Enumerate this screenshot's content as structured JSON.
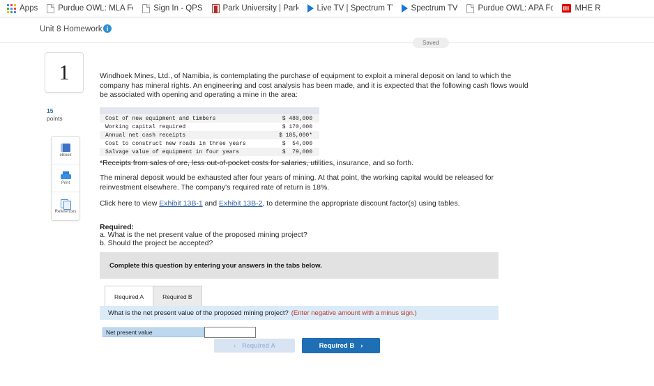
{
  "browser": {
    "apps_label": "Apps",
    "bookmarks": [
      {
        "label": "Purdue OWL: MLA Fo",
        "icon": "page-icon"
      },
      {
        "label": "Sign In - QPS",
        "icon": "page-icon"
      },
      {
        "label": "Park University | Park",
        "icon": "park-university-icon"
      },
      {
        "label": "Live TV | Spectrum TV",
        "icon": "play-triangle-icon"
      },
      {
        "label": "Spectrum TV",
        "icon": "play-triangle-icon"
      },
      {
        "label": "Purdue OWL: APA Fo",
        "icon": "page-icon"
      },
      {
        "label": "MHE R",
        "icon": "mhe-icon"
      }
    ]
  },
  "header": {
    "title": "Unit 8 Homework",
    "info_tooltip": "i",
    "status_badge": "Saved"
  },
  "sidebar": {
    "question_number": "1",
    "points_value": "15",
    "points_label": "points",
    "tools": [
      {
        "label": "eBook",
        "icon": "ebook-icon"
      },
      {
        "label": "Print",
        "icon": "printer-icon"
      },
      {
        "label": "References",
        "icon": "references-icon"
      }
    ]
  },
  "question": {
    "intro": "Windhoek Mines, Ltd., of Namibia, is contemplating the purchase of equipment to exploit a mineral deposit on land to which the company has mineral rights. An engineering and cost analysis has been made, and it is expected that the following cash flows would be associated with opening and operating a mine in the area:",
    "table": {
      "rows": [
        {
          "label": "Cost of new equipment and timbers",
          "amount": "$ 480,000"
        },
        {
          "label": "Working capital required",
          "amount": "$ 170,000"
        },
        {
          "label": "Annual net cash receipts",
          "amount": "$ 185,000*"
        },
        {
          "label": "Cost to construct new roads in three years",
          "amount": "$  54,000"
        },
        {
          "label": "Salvage value of equipment in four years",
          "amount": "$  79,000"
        }
      ]
    },
    "footnote": "*Receipts from sales of ore, less out-of-pocket costs for salaries, utilities, insurance, and so forth.",
    "para2": "The mineral deposit would be exhausted after four years of mining. At that point, the working capital would be released for reinvestment elsewhere. The company's required rate of return is 18%.",
    "para3_prefix": "Click here to view ",
    "exhibit_link_1": "Exhibit 13B-1",
    "para3_mid": " and ",
    "exhibit_link_2": "Exhibit 13B-2",
    "para3_suffix": ", to determine the appropriate discount factor(s) using tables.",
    "required_heading": "Required:",
    "required_a": "a. What is the net present value of the proposed mining project?",
    "required_b": "b. Should the project be accepted?"
  },
  "answer_panel": {
    "complete_banner": "Complete this question by entering your answers in the tabs below.",
    "tabs": [
      {
        "label": "Required A",
        "active": true
      },
      {
        "label": "Required B",
        "active": false
      }
    ],
    "prompt": "What is the net present value of the proposed mining project?",
    "prompt_hint": "(Enter negative amount with a minus sign.)",
    "field_label": "Net present value",
    "field_value": "",
    "field_placeholder": "",
    "prev_button": "Required A",
    "prev_chevron": "‹",
    "next_button": "Required B",
    "next_chevron": "›"
  },
  "colors": {
    "accent_blue": "#1f6fb5",
    "link_blue": "#2f5fa8",
    "hint_red": "#c0392b",
    "prompt_bg": "#daeaf7",
    "label_bg": "#bdd7ee"
  }
}
